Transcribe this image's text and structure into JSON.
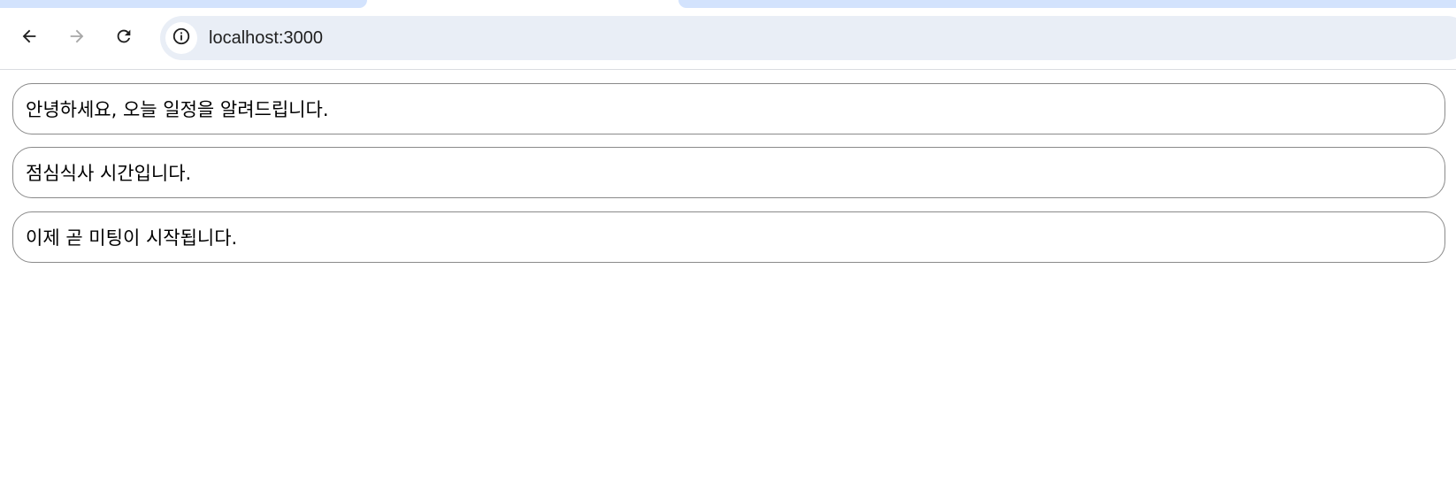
{
  "browser": {
    "url": "localhost:3000",
    "icons": {
      "back": "arrow-left-icon",
      "forward": "arrow-right-icon",
      "reload": "reload-icon",
      "site_info": "info-icon"
    }
  },
  "messages": [
    {
      "text": "안녕하세요, 오늘 일정을 알려드립니다."
    },
    {
      "text": "점심식사 시간입니다."
    },
    {
      "text": "이제 곧 미팅이 시작됩니다."
    }
  ],
  "colors": {
    "tab_strip": "#d3e3fd",
    "omnibox": "#e9eef6",
    "message_border": "#8a8a8a",
    "text": "#000000"
  }
}
